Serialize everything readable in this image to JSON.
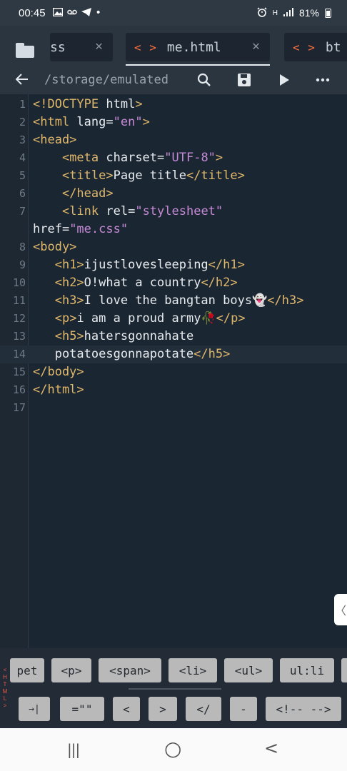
{
  "status": {
    "time": "00:45",
    "battery": "81%",
    "network_type": "H",
    "left_icons": [
      "gallery-icon",
      "voicemail-icon",
      "telegram-icon",
      "dot-icon"
    ],
    "right_icons": [
      "alarm-icon",
      "signal-icon",
      "battery-icon"
    ]
  },
  "tabs": [
    {
      "label": "ss",
      "icon": "code-icon",
      "active": false
    },
    {
      "label": "me.html",
      "icon": "code-icon",
      "active": true
    },
    {
      "label": "bt",
      "icon": "code-icon",
      "active": false
    }
  ],
  "toolbar": {
    "path": "/storage/emulated",
    "icons": [
      "back-arrow-icon",
      "search-icon",
      "save-icon",
      "play-icon",
      "more-icon"
    ]
  },
  "editor": {
    "lines": [
      {
        "n": "1",
        "parts": [
          [
            "tag",
            "<!DOCTYPE "
          ],
          [
            "txt",
            "html"
          ],
          [
            "tag",
            ">"
          ]
        ]
      },
      {
        "n": "2",
        "parts": [
          [
            "tag",
            "<html "
          ],
          [
            "attr",
            "lang="
          ],
          [
            "str",
            "\"en\""
          ],
          [
            "tag",
            ">"
          ]
        ]
      },
      {
        "n": "3",
        "parts": [
          [
            "tag",
            "<head>"
          ]
        ]
      },
      {
        "n": "4",
        "parts": [
          [
            "txt",
            "    "
          ],
          [
            "tag",
            "<meta "
          ],
          [
            "attr",
            "charset="
          ],
          [
            "str",
            "\"UTF-8\""
          ],
          [
            "tag",
            ">"
          ]
        ]
      },
      {
        "n": "5",
        "parts": [
          [
            "txt",
            "    "
          ],
          [
            "tag",
            "<title>"
          ],
          [
            "txt",
            "Page title"
          ],
          [
            "tag",
            "</title>"
          ]
        ]
      },
      {
        "n": "6",
        "parts": [
          [
            "txt",
            "    "
          ],
          [
            "tag",
            "</head>"
          ]
        ]
      },
      {
        "n": "7",
        "parts": [
          [
            "txt",
            "    "
          ],
          [
            "tag",
            "<link "
          ],
          [
            "attr",
            "rel="
          ],
          [
            "str",
            "\"stylesheet\""
          ]
        ]
      },
      {
        "n": "",
        "parts": [
          [
            "attr",
            "href="
          ],
          [
            "str",
            "\"me.css\""
          ]
        ]
      },
      {
        "n": "8",
        "parts": [
          [
            "tag",
            "<body>"
          ]
        ]
      },
      {
        "n": "9",
        "parts": [
          [
            "txt",
            "   "
          ],
          [
            "tag",
            "<h1>"
          ],
          [
            "txt",
            "ijustlovesleeping"
          ],
          [
            "tag",
            "</h1>"
          ]
        ]
      },
      {
        "n": "10",
        "parts": [
          [
            "txt",
            "   "
          ],
          [
            "tag",
            "<h2>"
          ],
          [
            "txt",
            "O!what a country"
          ],
          [
            "tag",
            "</h2>"
          ]
        ]
      },
      {
        "n": "11",
        "parts": [
          [
            "txt",
            "   "
          ],
          [
            "tag",
            "<h3>"
          ],
          [
            "txt",
            "I love the bangtan boys👻"
          ],
          [
            "tag",
            "</h3>"
          ]
        ]
      },
      {
        "n": "12",
        "parts": [
          [
            "txt",
            "   "
          ],
          [
            "tag",
            "<p>"
          ],
          [
            "txt",
            "i am a proud army🥀"
          ],
          [
            "tag",
            "</p>"
          ]
        ]
      },
      {
        "n": "13",
        "parts": [
          [
            "txt",
            "   "
          ],
          [
            "tag",
            "<h5>"
          ],
          [
            "txt",
            "hatersgonnahate"
          ]
        ]
      },
      {
        "n": "14",
        "parts": [
          [
            "txt",
            "   potatoesgonnapotate"
          ],
          [
            "tag",
            "</h5>"
          ]
        ]
      },
      {
        "n": "15",
        "parts": [
          [
            "tag",
            "</body>"
          ]
        ]
      },
      {
        "n": "16",
        "parts": [
          [
            "tag",
            "</html>"
          ]
        ]
      },
      {
        "n": "17",
        "parts": []
      }
    ],
    "current_line": 14
  },
  "snippets": {
    "side_label": [
      "H",
      "T",
      "M",
      "L"
    ],
    "row1": [
      "pet",
      "<p>",
      "<span>",
      "<li>",
      "<ul>",
      "ul:li"
    ],
    "row2": [
      "→|",
      "=\"\"",
      "<",
      ">",
      "</",
      "-",
      "<!-- -->"
    ]
  },
  "nav": {
    "icons": [
      "recents-icon",
      "home-icon",
      "back-icon"
    ],
    "recents": "|||",
    "home": "○",
    "back": "<"
  }
}
